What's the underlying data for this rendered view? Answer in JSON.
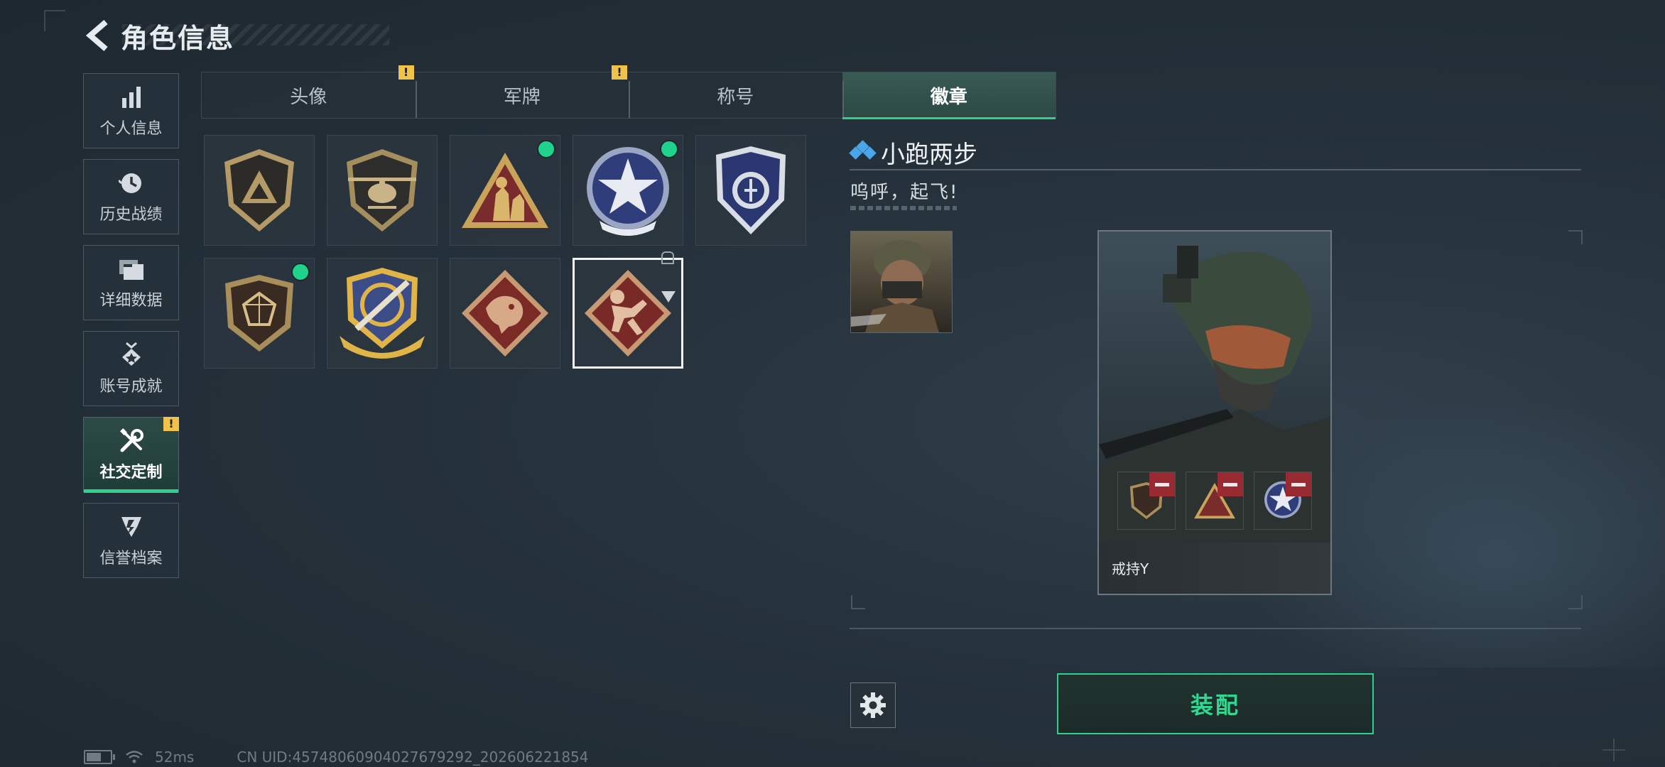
{
  "header": {
    "title": "角色信息"
  },
  "sidebar": {
    "items": [
      {
        "label": "个人信息",
        "icon": "bar-chart-icon",
        "active": false,
        "warning": false
      },
      {
        "label": "历史战绩",
        "icon": "history-icon",
        "active": false,
        "warning": false
      },
      {
        "label": "详细数据",
        "icon": "folders-icon",
        "active": false,
        "warning": false
      },
      {
        "label": "账号成就",
        "icon": "achievement-icon",
        "active": false,
        "warning": false
      },
      {
        "label": "社交定制",
        "icon": "tools-icon",
        "active": true,
        "warning": true
      },
      {
        "label": "信誉档案",
        "icon": "reputation-icon",
        "active": false,
        "warning": false
      }
    ]
  },
  "tabs": [
    {
      "label": "头像",
      "warning": true,
      "active": false
    },
    {
      "label": "军牌",
      "warning": true,
      "active": false
    },
    {
      "label": "称号",
      "warning": false,
      "active": false
    },
    {
      "label": "徽章",
      "warning": false,
      "active": true
    }
  ],
  "warning_mark": "!",
  "badges": [
    {
      "name": "triangle-shield-badge",
      "equipped": false
    },
    {
      "name": "helicopter-badge",
      "equipped": false
    },
    {
      "name": "soldiers-triangle-badge",
      "equipped": true
    },
    {
      "name": "star-crest-badge",
      "equipped": true
    },
    {
      "name": "blue-shield-badge",
      "equipped": false
    },
    {
      "name": "gem-shield-badge",
      "equipped": true
    },
    {
      "name": "rifle-crest-badge",
      "equipped": false
    },
    {
      "name": "dragon-diamond-badge",
      "equipped": false
    },
    {
      "name": "runner-diamond-badge",
      "equipped": false,
      "selected": true
    }
  ],
  "profile": {
    "name": "小跑两步",
    "motto": "呜呼，起飞!",
    "card_name": "戒持Y"
  },
  "actions": {
    "equip_label": "装配"
  },
  "status": {
    "ping": "52ms",
    "uid": "CN UID:45748060904027679292_202606221854"
  },
  "colors": {
    "accent": "#2fcf8c",
    "warning": "#f0c24a",
    "name_icon": "#4aa6e8"
  }
}
